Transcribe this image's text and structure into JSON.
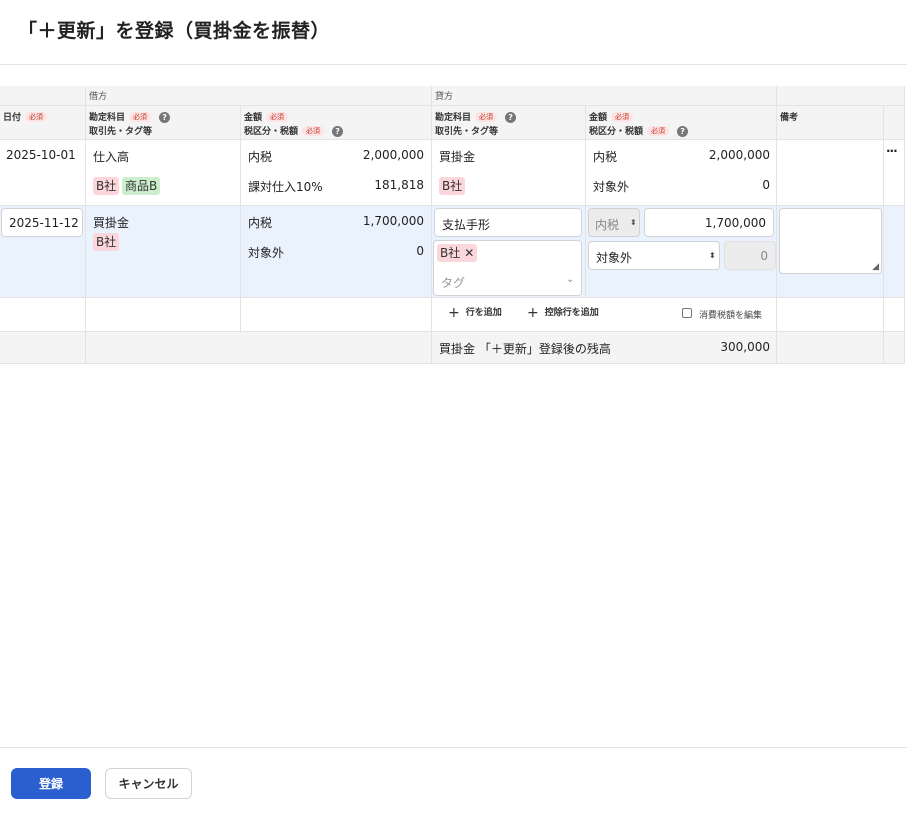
{
  "title": "「＋更新」を登録（買掛金を振替）",
  "header": {
    "debit_group": "借方",
    "credit_group": "貸方",
    "date": "日付",
    "required": "必須",
    "account": "勘定科目",
    "partner_tag": "取引先・タグ等",
    "amount": "金額",
    "tax": "税区分・税額",
    "memo": "備考",
    "help": "?"
  },
  "row1": {
    "date": "2025-10-01",
    "debit_account": "仕入高",
    "debit_tags": [
      "B社",
      "商品B"
    ],
    "debit_tax_type": "内税",
    "debit_amount": "2,000,000",
    "debit_tax_class": "課対仕入10%",
    "debit_tax_amount": "181,818",
    "credit_account": "買掛金",
    "credit_tags": [
      "B社"
    ],
    "credit_tax_type": "内税",
    "credit_amount": "2,000,000",
    "credit_tax_class": "対象外",
    "credit_tax_amount": "0",
    "menu": "···"
  },
  "row2": {
    "date": "2025-11-12",
    "debit_account": "買掛金",
    "debit_tags": [
      "B社"
    ],
    "debit_tax_type": "内税",
    "debit_amount": "1,700,000",
    "debit_tax_class": "対象外",
    "debit_tax_amount": "0",
    "credit_account": "支払手形",
    "credit_tag_chip": "B社",
    "credit_tag_placeholder": "タグ",
    "credit_tax_type": "内税",
    "credit_amount": "1,700,000",
    "credit_tax_class": "対象外",
    "credit_tax_amount": "0"
  },
  "actions": {
    "add_row": "行を追加",
    "add_deduction_row": "控除行を追加",
    "edit_consumption_tax": "消費税額を編集"
  },
  "balance": {
    "label": "買掛金 「＋更新」登録後の残高",
    "value": "300,000"
  },
  "footer": {
    "submit": "登録",
    "cancel": "キャンセル"
  },
  "colors": {
    "primary": "#2b5fcf",
    "row_highlight": "#eaf2fd",
    "tag_pink": "#fbd6db",
    "tag_green": "#cdeecd"
  }
}
